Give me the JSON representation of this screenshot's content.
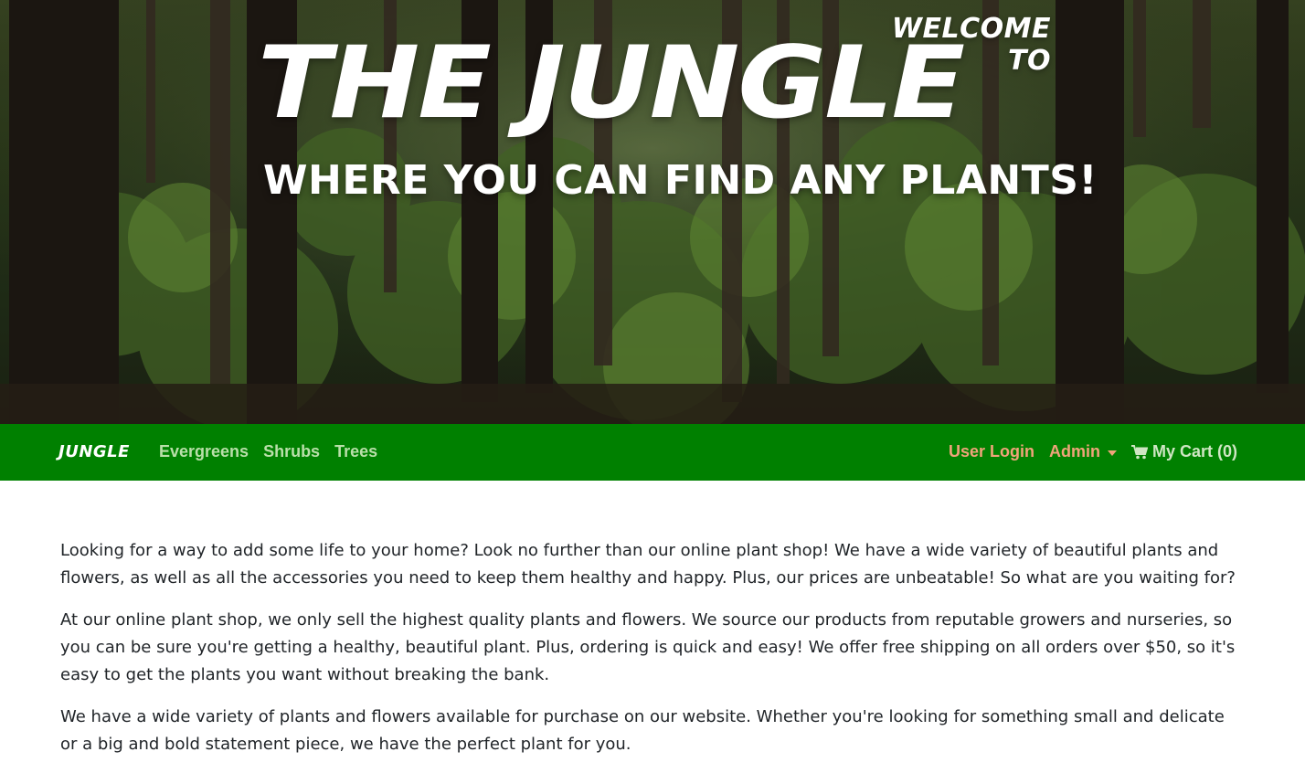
{
  "hero": {
    "welcome": "WELCOME TO",
    "title": "THE JUNGLE",
    "tagline": "WHERE YOU CAN FIND ANY PLANTS!"
  },
  "navbar": {
    "brand": "JUNGLE",
    "left_links": [
      "Evergreens",
      "Shrubs",
      "Trees"
    ],
    "user_login": "User Login",
    "admin": "Admin",
    "cart": "My Cart (0)",
    "colors": {
      "background": "#008000",
      "link": "#b9dfa9",
      "accent": "#f0a47a"
    }
  },
  "content": {
    "paragraphs": [
      "Looking for a way to add some life to your home? Look no further than our online plant shop! We have a wide variety of beautiful plants and flowers, as well as all the accessories you need to keep them healthy and happy. Plus, our prices are unbeatable! So what are you waiting for?",
      "At our online plant shop, we only sell the highest quality plants and flowers. We source our products from reputable growers and nurseries, so you can be sure you're getting a healthy, beautiful plant. Plus, ordering is quick and easy! We offer free shipping on all orders over $50, so it's easy to get the plants you want without breaking the bank.",
      "We have a wide variety of plants and flowers available for purchase on our website. Whether you're looking for something small and delicate or a big and bold statement piece, we have the perfect plant for you."
    ]
  }
}
